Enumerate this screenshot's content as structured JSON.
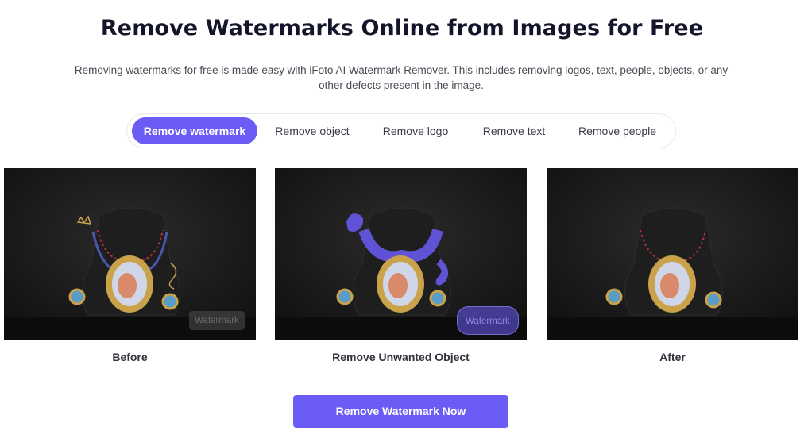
{
  "header": {
    "title": "Remove Watermarks Online from Images for Free",
    "description": "Removing watermarks for free is made easy with iFoto AI Watermark Remover. This includes removing logos, text, people, objects, or any other defects present in the image."
  },
  "tabs": [
    {
      "label": "Remove watermark",
      "active": true
    },
    {
      "label": "Remove object",
      "active": false
    },
    {
      "label": "Remove logo",
      "active": false
    },
    {
      "label": "Remove text",
      "active": false
    },
    {
      "label": "Remove people",
      "active": false
    }
  ],
  "panels": [
    {
      "caption": "Before",
      "watermark_text": "Watermark"
    },
    {
      "caption": "Remove Unwanted Object",
      "watermark_text": "Watermark"
    },
    {
      "caption": "After"
    }
  ],
  "cta": {
    "label": "Remove Watermark Now"
  },
  "colors": {
    "accent": "#6b5cf6",
    "title": "#14142b",
    "photo_bg": "#151515"
  }
}
